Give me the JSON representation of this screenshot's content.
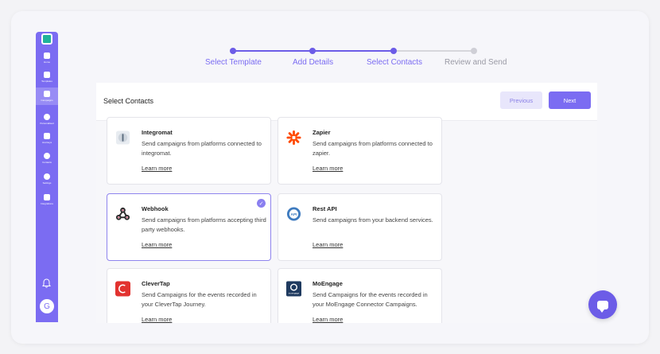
{
  "sidebar": {
    "items": [
      {
        "label": "Home",
        "active": false
      },
      {
        "label": "Templates",
        "active": false
      },
      {
        "label": "Campaigns",
        "active": true
      },
      {
        "label": "Personalised",
        "active": false
      },
      {
        "label": "Journeys",
        "active": false
      },
      {
        "label": "Contacts",
        "active": false
      },
      {
        "label": "Settings",
        "active": false
      },
      {
        "label": "Integrations",
        "active": false
      }
    ],
    "avatar_initial": "G"
  },
  "stepper": {
    "steps": [
      {
        "label": "Select Template",
        "done": true
      },
      {
        "label": "Add Details",
        "done": true
      },
      {
        "label": "Select Contacts",
        "done": true
      },
      {
        "label": "Review and Send",
        "done": false
      }
    ]
  },
  "panel": {
    "title": "Select Contacts",
    "previous_label": "Previous",
    "next_label": "Next"
  },
  "integrations": [
    {
      "name": "Integromat",
      "description": "Send campaigns from platforms connected to integromat.",
      "link": "Learn more",
      "selected": false
    },
    {
      "name": "Zapier",
      "description": "Send campaigns from platforms connected to zapier.",
      "link": "Learn more",
      "selected": false
    },
    {
      "name": "Webhook",
      "description": "Send campaigns from platforms accepting third party webhooks.",
      "link": "Learn more",
      "selected": true
    },
    {
      "name": "Rest API",
      "description": "Send campaigns from your backend services.",
      "link": "Learn more",
      "selected": false
    },
    {
      "name": "CleverTap",
      "description": "Send Campaigns for the events recorded in your CleverTap Journey.",
      "link": "Learn more",
      "selected": false
    },
    {
      "name": "MoEngage",
      "description": "Send Campaigns for the events recorded in your MoEngage Connector Campaigns.",
      "link": "Learn more",
      "selected": false
    }
  ],
  "icon_text": {
    "rest_api": "API",
    "moengage": "moengage"
  },
  "colors": {
    "accent": "#7b6cf2",
    "accent_dark": "#6c5ce7",
    "sidebar_bg": "#7b6cf2"
  }
}
